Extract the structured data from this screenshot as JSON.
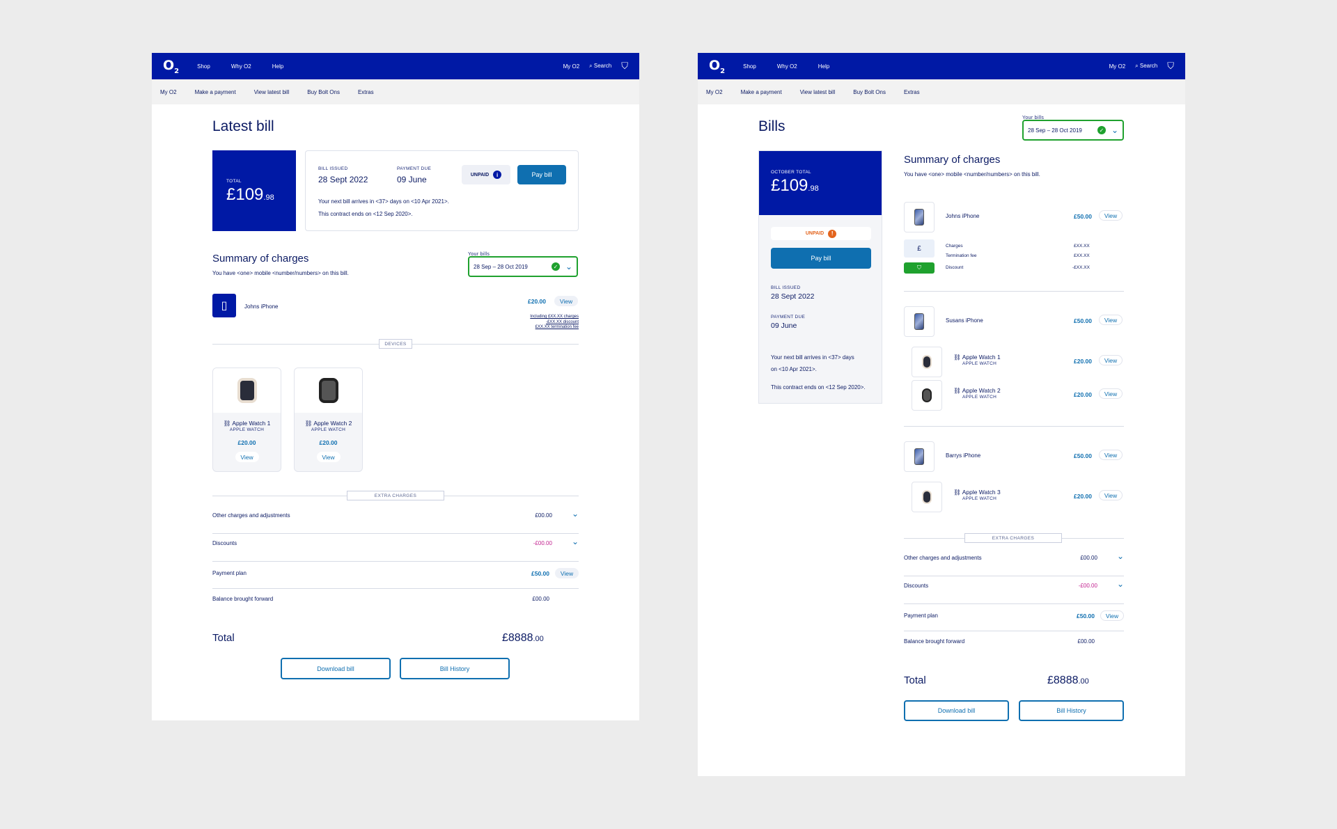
{
  "nav": {
    "logo": "O",
    "logo_sub": "2",
    "links": [
      "Shop",
      "Why O2",
      "Help"
    ],
    "my_o2": "My O2",
    "search": "Search",
    "subnav": [
      "My O2",
      "Make a payment",
      "View latest bill",
      "Buy Bolt Ons",
      "Extras"
    ]
  },
  "left": {
    "title": "Latest bill",
    "total_label": "TOTAL",
    "total_main": "£109",
    "total_pence": ".98",
    "bill_issued_label": "BILL ISSUED",
    "bill_issued": "28 Sept 2022",
    "payment_due_label": "PAYMENT DUE",
    "payment_due": "09 June",
    "status": "UNPAID",
    "pay_button": "Pay bill",
    "next_bill": "Your next bill arrives in <37> days on <10 Apr 2021>.",
    "contract": "This contract ends on <12 Sep 2020>.",
    "summary_title": "Summary of charges",
    "summary_sub": "You have <one> mobile <number/numbers> on this bill.",
    "your_bills_label": "Your bills",
    "your_bills_value": "28 Sep – 28 Oct 2019",
    "phone_name": "Johns iPhone",
    "phone_price": "£20.00",
    "view": "View",
    "including": [
      "Including £XX.XX charges",
      "-£XX.XX discount",
      "£XX.XX termination fee"
    ],
    "devices_label": "DEVICES",
    "devices": [
      {
        "name": "Apple Watch 1",
        "type": "APPLE WATCH",
        "price": "£20.00",
        "view": "View"
      },
      {
        "name": "Apple Watch 2",
        "type": "APPLE WATCH",
        "price": "£20.00",
        "view": "View"
      }
    ],
    "extra_label": "EXTRA CHARGES",
    "extras": [
      {
        "label": "Other charges and adjustments",
        "value": "£00.00"
      },
      {
        "label": "Discounts",
        "value": "-£00.00"
      },
      {
        "label": "Payment plan",
        "value": "£50.00",
        "view": "View"
      },
      {
        "label": "Balance brought forward",
        "value": "£00.00"
      }
    ],
    "total_row_label": "Total",
    "total_row_main": "£8888",
    "total_row_pence": ".00",
    "download": "Download bill",
    "history": "Bill History"
  },
  "right": {
    "title": "Bills",
    "your_bills_label": "Your bills",
    "your_bills_value": "28 Sep – 28 Oct 2019",
    "card_label": "OCTOBER TOTAL",
    "total_main": "£109",
    "total_pence": ".98",
    "status": "UNPAID",
    "pay_button": "Pay bill",
    "bill_issued_label": "BILL ISSUED",
    "bill_issued": "28 Sept 2022",
    "payment_due_label": "PAYMENT DUE",
    "payment_due": "09 June",
    "next_bill_1": "Your next bill arrives in <37> days",
    "next_bill_2": "on <10 Apr 2021>.",
    "contract": "This contract ends on <12 Sep 2020>.",
    "summary_title": "Summary of charges",
    "summary_sub": "You have <one> mobile <number/numbers> on this bill.",
    "view": "View",
    "john": {
      "name": "Johns iPhone",
      "price": "£50.00",
      "charges_label": "Charges",
      "charges": "£XX.XX",
      "termination_label": "Termination fee",
      "termination": "£XX.XX",
      "discount_label": "Discount",
      "discount": "-£XX.XX"
    },
    "susan": {
      "name": "Susans iPhone",
      "price": "£50.00",
      "watches": [
        {
          "name": "Apple Watch 1",
          "type": "APPLE WATCH",
          "price": "£20.00"
        },
        {
          "name": "Apple Watch 2",
          "type": "APPLE WATCH",
          "price": "£20.00"
        }
      ]
    },
    "barry": {
      "name": "Barrys iPhone",
      "price": "£50.00",
      "watches": [
        {
          "name": "Apple Watch 3",
          "type": "APPLE WATCH",
          "price": "£20.00"
        }
      ]
    },
    "extra_label": "EXTRA CHARGES",
    "extras": [
      {
        "label": "Other charges and adjustments",
        "value": "£00.00"
      },
      {
        "label": "Discounts",
        "value": "-£00.00"
      },
      {
        "label": "Payment plan",
        "value": "£50.00",
        "view": "View"
      },
      {
        "label": "Balance brought forward",
        "value": "£00.00"
      }
    ],
    "total_row_label": "Total",
    "total_row_main": "£8888",
    "total_row_pence": ".00",
    "download": "Download bill",
    "history": "Bill History"
  }
}
